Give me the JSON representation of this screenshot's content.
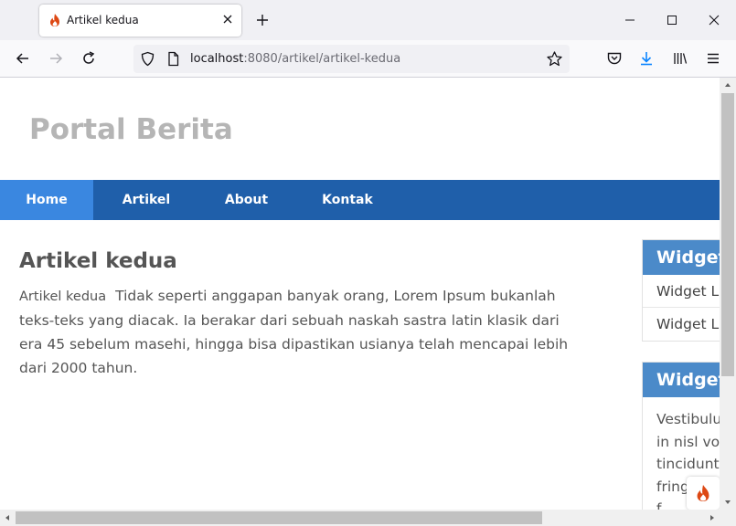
{
  "browser": {
    "tab_title": "Artikel kedua",
    "url_host": "localhost",
    "url_rest": ":8080/artikel/artikel-kedua"
  },
  "site": {
    "title": "Portal Berita",
    "nav": [
      {
        "label": "Home",
        "active": true
      },
      {
        "label": "Artikel",
        "active": false
      },
      {
        "label": "About",
        "active": false
      },
      {
        "label": "Kontak",
        "active": false
      }
    ]
  },
  "article": {
    "heading": "Artikel kedua",
    "inline_title": "Artikel kedua",
    "body": "Tidak seperti anggapan banyak orang, Lorem Ipsum bukanlah teks-teks yang diacak. Ia berakar dari sebuah naskah sastra latin klasik dari era 45 sebelum masehi, hingga bisa dipastikan usianya telah mencapai lebih dari 2000 tahun."
  },
  "sidebar": {
    "widget1": {
      "header": "Widget",
      "links": [
        "Widget Li",
        "Widget Li"
      ]
    },
    "widget2": {
      "header": "Widget",
      "lines": [
        "Vestibulu",
        "in nisl vol",
        "tincidunt",
        "fring",
        "f"
      ]
    }
  },
  "colors": {
    "nav_bg": "#1f5faa",
    "nav_active": "#3a87e0",
    "widget_head": "#4b8ac9",
    "site_title": "#b5b5b5"
  }
}
